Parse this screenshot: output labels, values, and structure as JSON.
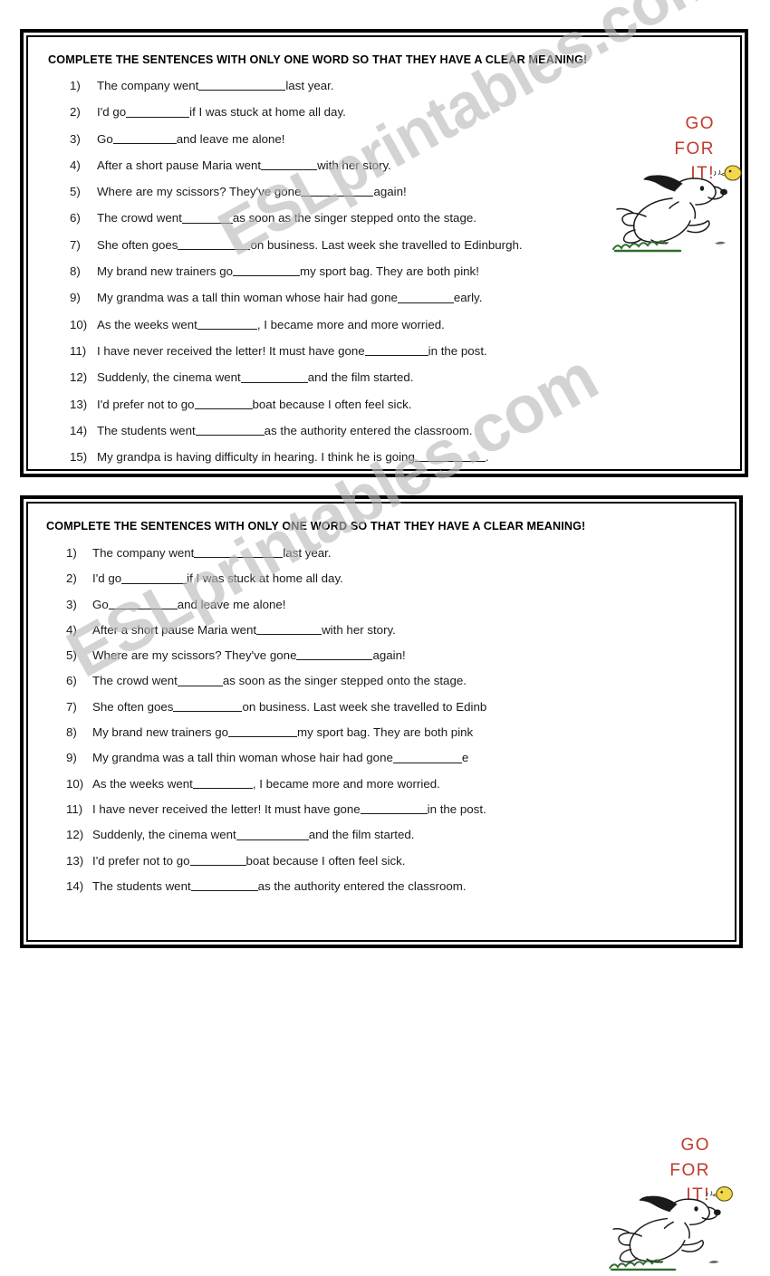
{
  "document": {
    "type": "esl-worksheet",
    "watermark": "ESLprintables.com"
  },
  "colors": {
    "ink": "#1a1a1a",
    "frame": "#000000",
    "accent_red": "#c0392b",
    "bird_yellow": "#f2d84b",
    "grass_green": "#2f6b2f",
    "watermark_gray": "#b9b9b9"
  },
  "panels": [
    {
      "title": "COMPLETE THE SENTENCES WITH ONLY ONE WORD SO THAT THEY HAVE A CLEAR MEANING!",
      "questions": [
        {
          "num": "1)",
          "before": "The company went ",
          "blank": 96,
          "after": " last year."
        },
        {
          "num": "2)",
          "before": " I'd go ",
          "blank": 70,
          "after": " if I was stuck at home all day."
        },
        {
          "num": "3)",
          "before": "Go ",
          "blank": 70,
          "after": " and leave me alone!"
        },
        {
          "num": "4)",
          "before": "After a short pause Maria went ",
          "blank": 62,
          "after": " with her story."
        },
        {
          "num": "5)",
          "before": "Where are my scissors? They've gone ",
          "blank": 80,
          "after": " again!"
        },
        {
          "num": "6)",
          "before": "The crowd went ",
          "blank": 56,
          "after": " as soon as the singer stepped onto the stage."
        },
        {
          "num": "7)",
          "before": "She often goes",
          "blank": 80,
          "after": " on business. Last week she travelled to Edinburgh."
        },
        {
          "num": "8)",
          "before": "My brand new trainers go ",
          "blank": 74,
          "after": " my sport bag. They are both pink!"
        },
        {
          "num": "9)",
          "before": "My grandma was a tall thin woman whose hair had gone ",
          "blank": 62,
          "after": " early."
        },
        {
          "num": "10)",
          "before": "As the weeks went ",
          "blank": 66,
          "after": ", I became more and more worried."
        },
        {
          "num": "11)",
          "before": "I have never received the letter! It must have gone ",
          "blank": 70,
          "after": " in the post."
        },
        {
          "num": "12)",
          "before": "Suddenly, the cinema went ",
          "blank": 74,
          "after": " and the film started."
        },
        {
          "num": "13)",
          "before": "I'd prefer not to go ",
          "blank": 64,
          "after": " boat because I often feel sick."
        },
        {
          "num": "14)",
          "before": "The students went ",
          "blank": 76,
          "after": " as the authority entered the classroom."
        },
        {
          "num": "15)",
          "before": "My grandpa is having difficulty in hearing. I think he is going ",
          "blank": 78,
          "after": "."
        }
      ],
      "clipart": {
        "name": "snoopy-running",
        "caption_lines": [
          "GO",
          "FOR",
          "IT!"
        ]
      }
    },
    {
      "title": "COMPLETE THE SENTENCES WITH ONLY ONE WORD SO THAT THEY HAVE A CLEAR MEANING!",
      "questions": [
        {
          "num": "1)",
          "before": "The company went",
          "blank": 98,
          "after": " last year."
        },
        {
          "num": "2)",
          "before": " I'd go",
          "blank": 72,
          "after": " if I was stuck at home all day."
        },
        {
          "num": "3)",
          "before": "Go ",
          "blank": 76,
          "after": " and leave me alone!"
        },
        {
          "num": "4)",
          "before": "After a short pause Maria went ",
          "blank": 72,
          "after": " with her story."
        },
        {
          "num": "5)",
          "before": "Where are my scissors? They've gone ",
          "blank": 84,
          "after": " again!"
        },
        {
          "num": "6)",
          "before": "The crowd went ",
          "blank": 50,
          "after": " as soon as the singer stepped onto the stage."
        },
        {
          "num": "7)",
          "before": "She often goes",
          "blank": 76,
          "after": " on business. Last week she travelled to Edinb"
        },
        {
          "num": "8)",
          "before": "My brand new trainers go ",
          "blank": 76,
          "after": " my sport bag. They are both pink"
        },
        {
          "num": "9)",
          "before": "My grandma was a tall thin woman whose hair had gone ",
          "blank": 76,
          "after": " e"
        },
        {
          "num": "10)",
          "before": "As the weeks went ",
          "blank": 66,
          "after": ", I became more and more worried."
        },
        {
          "num": "11)",
          "before": "I have never received the letter! It must have gone ",
          "blank": 74,
          "after": " in the post."
        },
        {
          "num": "12)",
          "before": "Suddenly, the cinema went ",
          "blank": 80,
          "after": " and the film started."
        },
        {
          "num": "13)",
          "before": "I'd prefer not to go ",
          "blank": 62,
          "after": " boat because I often feel sick."
        },
        {
          "num": "14)",
          "before": "The students went ",
          "blank": 74,
          "after": "as the authority entered the classroom."
        }
      ],
      "clipart": {
        "name": "snoopy-running",
        "caption_lines": [
          "GO",
          "FOR",
          "IT!"
        ]
      }
    }
  ]
}
